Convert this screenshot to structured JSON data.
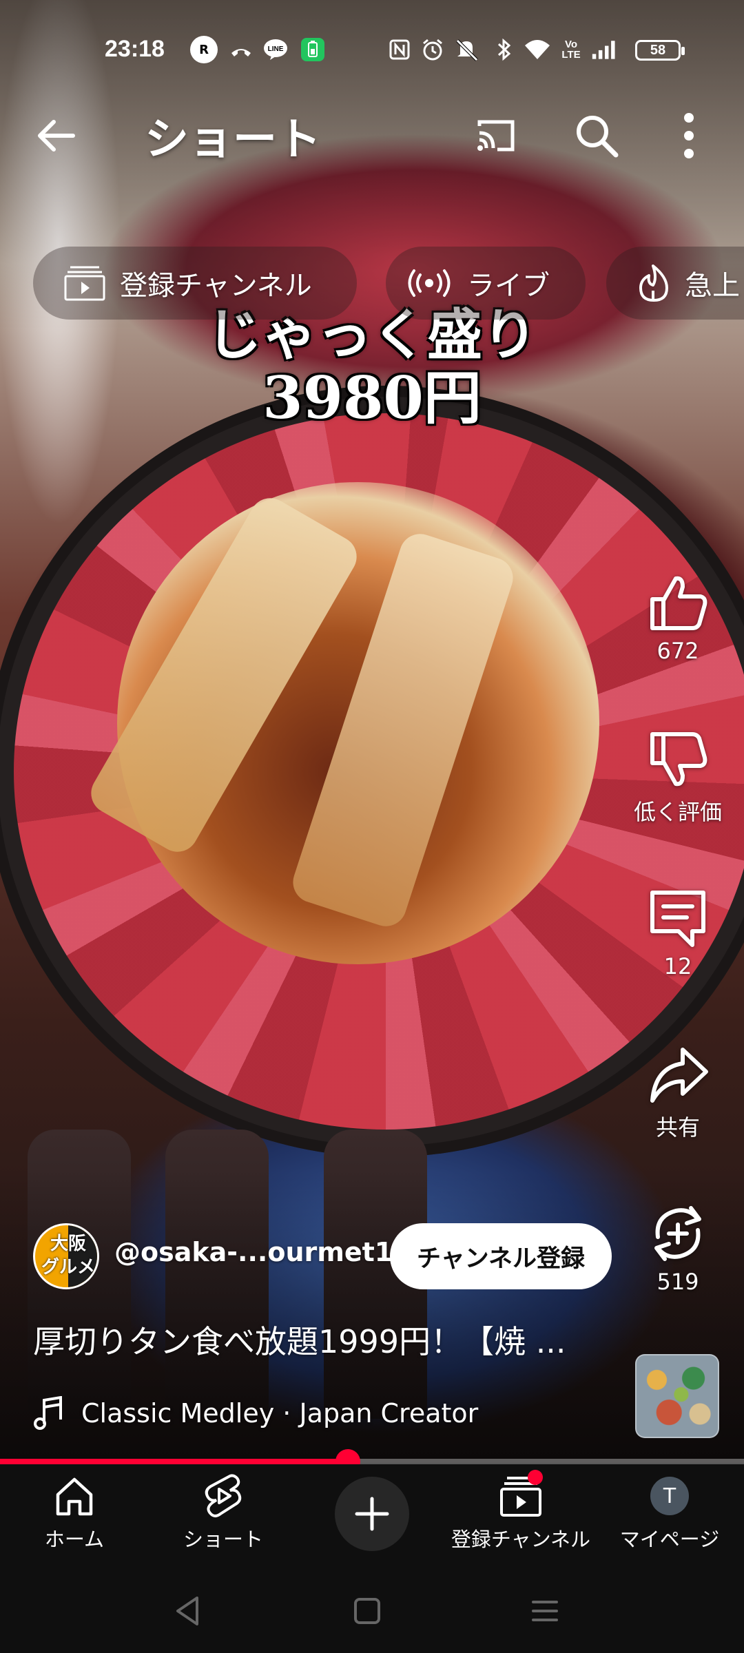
{
  "status_bar": {
    "time": "23:18",
    "battery": "58",
    "left_icons": [
      "r-line-icon",
      "missed-call-icon",
      "line-app-icon",
      "battery-saver-icon"
    ],
    "right_icons": [
      "nfc-icon",
      "alarm-icon",
      "mute-icon",
      "bluetooth-icon",
      "wifi-icon",
      "volte-icon",
      "signal-icon"
    ],
    "volte_text": "Vo LTE"
  },
  "top_bar": {
    "title": "ショート"
  },
  "chips": [
    {
      "label": "登録チャンネル",
      "icon": "subscriptions-icon"
    },
    {
      "label": "ライブ",
      "icon": "live-icon"
    },
    {
      "label": "急上",
      "icon": "trending-icon"
    }
  ],
  "overlay": {
    "line1": "じゃっく盛り",
    "line2": "3980円"
  },
  "actions": {
    "like_count": "672",
    "dislike_label": "低く評価",
    "comment_count": "12",
    "share_label": "共有",
    "remix_count": "519"
  },
  "channel": {
    "avatar_text_top": "大阪",
    "avatar_text_bottom": "グルメ",
    "handle": "@osaka-...ourmet1",
    "subscribe_label": "チャンネル登録"
  },
  "video": {
    "title": "厚切りタン食べ放題1999円！【焼 ...",
    "music": "Classic Medley · Japan Creator",
    "progress": 0.468
  },
  "bottom_nav": {
    "home": "ホーム",
    "shorts": "ショート",
    "subscriptions": "登録チャンネル",
    "mypage": "マイページ",
    "mypage_initial": "T"
  },
  "colors": {
    "accent": "#ff0033",
    "nav_bg": "#0f0f0f"
  }
}
